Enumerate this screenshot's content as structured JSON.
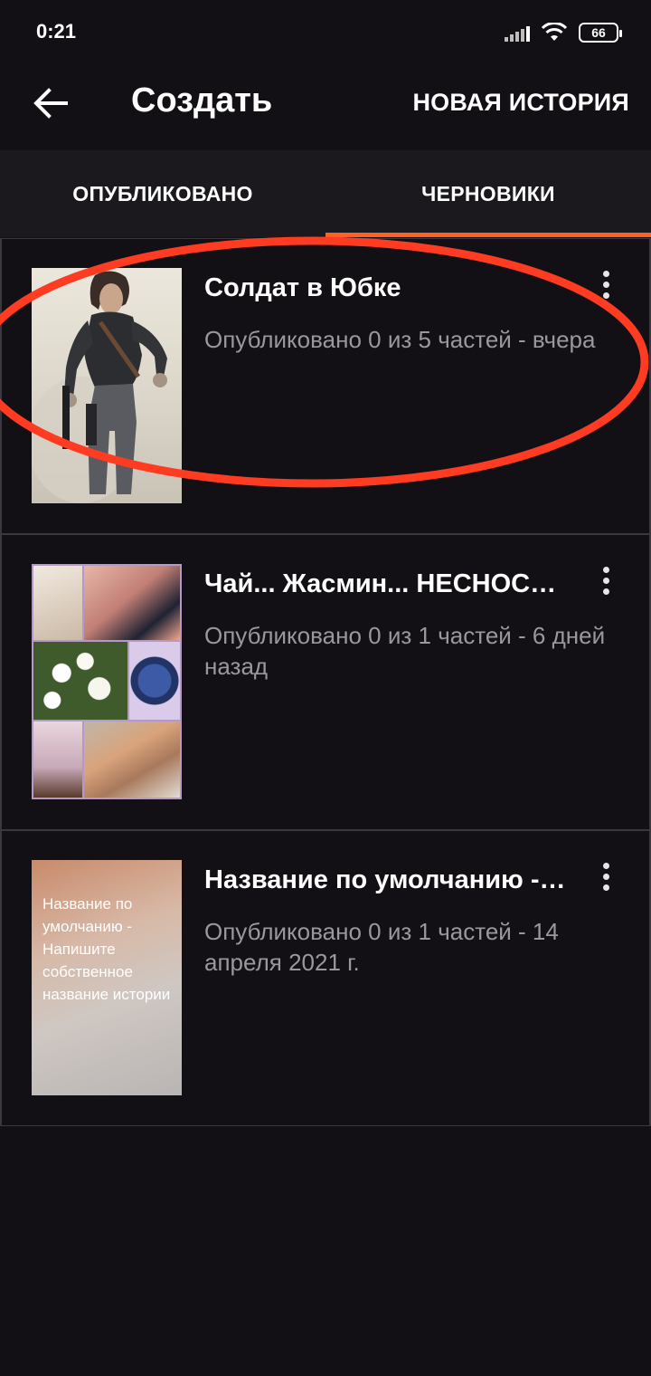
{
  "status_bar": {
    "time": "0:21",
    "battery": "66",
    "icons": [
      "signal-icon",
      "wifi-icon",
      "battery-icon"
    ]
  },
  "app_bar": {
    "title": "Создать",
    "new_story_label": "НОВАЯ ИСТОРИЯ",
    "back_icon": "arrow-left-icon"
  },
  "tabs": {
    "published_label": "ОПУБЛИКОВАНО",
    "drafts_label": "ЧЕРНОВИКИ",
    "active": "drafts"
  },
  "stories": [
    {
      "title": "Солдат в Юбке",
      "meta": "Опубликовано 0 из 5 частей - вчера"
    },
    {
      "title": "Чай... Жасмин... НЕСНОСНЫЙ",
      "meta": "Опубликовано 0 из 1 частей - 6 дней назад"
    },
    {
      "title": "Название по умолчанию - Напишите собственное название истории",
      "meta": "Опубликовано 0 из 1 частей - 14 апреля 2021 г.",
      "cover_text": "Название по умолчанию - Напишите собственное название истории"
    }
  ],
  "colors": {
    "background": "#121015",
    "tab_bar": "#1b191e",
    "accent": "#ff6122",
    "meta_text": "#9a989d",
    "annotation": "#ff3b22"
  }
}
